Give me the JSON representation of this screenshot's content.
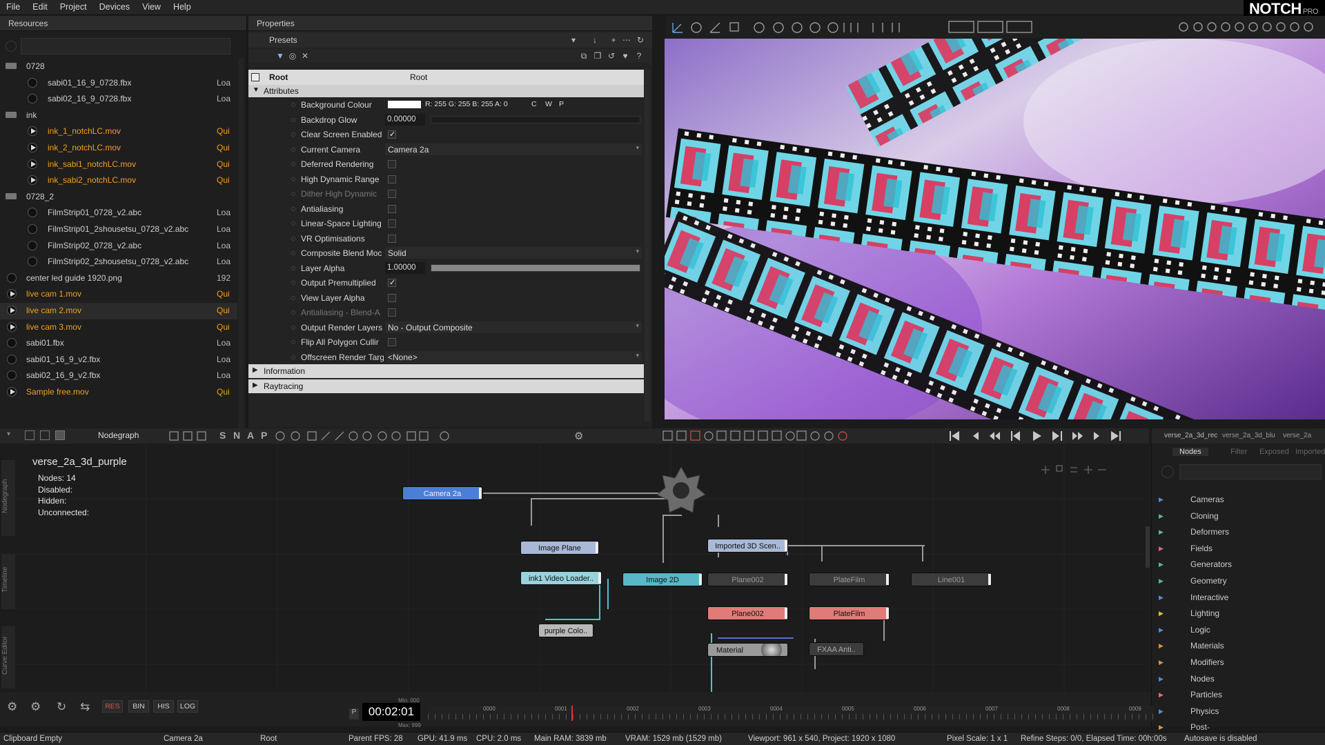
{
  "menu": [
    "File",
    "Edit",
    "Project",
    "Devices",
    "View",
    "Help"
  ],
  "logo": {
    "brand": "NOTCH",
    "edition": "PRO"
  },
  "resources": {
    "title": "Resources",
    "items": [
      {
        "name": "0728",
        "type": "folder",
        "status": ""
      },
      {
        "name": "sabi01_16_9_0728.fbx",
        "type": "model",
        "status": "Loa"
      },
      {
        "name": "sabi02_16_9_0728.fbx",
        "type": "model",
        "status": "Loa"
      },
      {
        "name": "ink",
        "type": "folder",
        "status": ""
      },
      {
        "name": "ink_1_notchLC.mov",
        "type": "video",
        "status": "Qui",
        "highlight": true
      },
      {
        "name": "ink_2_notchLC.mov",
        "type": "video",
        "status": "Qui",
        "highlight": true
      },
      {
        "name": "ink_sabi1_notchLC.mov",
        "type": "video",
        "status": "Qui",
        "highlight": true
      },
      {
        "name": "ink_sabi2_notchLC.mov",
        "type": "video",
        "status": "Qui",
        "highlight": true
      },
      {
        "name": "0728_2",
        "type": "folder",
        "status": ""
      },
      {
        "name": "FilmStrip01_0728_v2.abc",
        "type": "model",
        "status": "Loa"
      },
      {
        "name": "FilmStrip01_2shousetsu_0728_v2.abc",
        "type": "model",
        "status": "Loa"
      },
      {
        "name": "FilmStrip02_0728_v2.abc",
        "type": "model",
        "status": "Loa"
      },
      {
        "name": "FilmStrip02_2shousetsu_0728_v2.abc",
        "type": "model",
        "status": "Loa"
      },
      {
        "name": "center led guide 1920.png",
        "type": "image",
        "status": "192"
      },
      {
        "name": "live cam 1.mov",
        "type": "video",
        "status": "Qui",
        "highlight": true
      },
      {
        "name": "live cam 2.mov",
        "type": "video",
        "status": "Qui",
        "highlight": true,
        "selected": true
      },
      {
        "name": "live cam 3.mov",
        "type": "video",
        "status": "Qui",
        "highlight": true
      },
      {
        "name": "sabi01.fbx",
        "type": "model",
        "status": "Loa"
      },
      {
        "name": "sabi01_16_9_v2.fbx",
        "type": "model",
        "status": "Loa"
      },
      {
        "name": "sabi02_16_9_v2.fbx",
        "type": "model",
        "status": "Loa"
      },
      {
        "name": "Sample free.mov",
        "type": "video",
        "status": "Qui",
        "highlight": true
      }
    ]
  },
  "properties": {
    "title": "Properties",
    "presets_label": "Presets",
    "root_label": "Root",
    "root_value": "Root",
    "attributes_label": "Attributes",
    "rows": [
      {
        "label": "Background Colour",
        "kind": "color",
        "value": "R: 255 G: 255 B: 255 A: 0",
        "extra": [
          "C",
          "W",
          "P"
        ]
      },
      {
        "label": "Backdrop Glow",
        "kind": "number",
        "value": "0.00000",
        "fill": 0
      },
      {
        "label": "Clear Screen Enabled",
        "kind": "check",
        "checked": true
      },
      {
        "label": "Current Camera",
        "kind": "dropdown",
        "value": "Camera 2a"
      },
      {
        "label": "Deferred Rendering",
        "kind": "check",
        "checked": false
      },
      {
        "label": "High Dynamic Range",
        "kind": "check",
        "checked": false
      },
      {
        "label": "Dither High Dynamic",
        "kind": "check",
        "checked": false,
        "dim": true
      },
      {
        "label": "Antialiasing",
        "kind": "check",
        "checked": false
      },
      {
        "label": "Linear-Space Lighting",
        "kind": "check",
        "checked": false
      },
      {
        "label": "VR Optimisations",
        "kind": "check",
        "checked": false
      },
      {
        "label": "Composite Blend Moc",
        "kind": "dropdown",
        "value": "Solid"
      },
      {
        "label": "Layer Alpha",
        "kind": "number",
        "value": "1.00000",
        "fill": 1
      },
      {
        "label": "Output Premultiplied",
        "kind": "check",
        "checked": true
      },
      {
        "label": "View Layer Alpha",
        "kind": "check",
        "checked": false
      },
      {
        "label": "Antialiasing - Blend-A",
        "kind": "check",
        "checked": false,
        "dim": true
      },
      {
        "label": "Output Render Layers",
        "kind": "dropdown",
        "value": "No - Output Composite"
      },
      {
        "label": "Flip All Polygon Cullir",
        "kind": "check",
        "checked": false
      },
      {
        "label": "Offscreen Render Targ",
        "kind": "dropdown",
        "value": "<None>"
      }
    ],
    "sections": [
      "Information",
      "Raytracing"
    ]
  },
  "nodegraph": {
    "toolbar_label": "Nodegraph",
    "toolbar_letters": [
      "S",
      "N",
      "A",
      "P"
    ],
    "layer_name": "verse_2a_3d_purple",
    "info": [
      {
        "k": "Nodes:",
        "v": "14"
      },
      {
        "k": "Disabled:",
        "v": ""
      },
      {
        "k": "Hidden:",
        "v": ""
      },
      {
        "k": "Unconnected:",
        "v": ""
      }
    ],
    "side_tabs": [
      "Nodegraph",
      "Timeline",
      "Curve Editor"
    ],
    "nodes": [
      {
        "id": "camera",
        "label": "Camera 2a",
        "color": "#4a7fd8"
      },
      {
        "id": "imageplane",
        "label": "Image Plane",
        "color": "#a8b8d6"
      },
      {
        "id": "ink1video",
        "label": "ink1 Video Loader..",
        "color": "#98d2dc"
      },
      {
        "id": "purplecolor",
        "label": "purple Colo..",
        "color": "#b8b8b8"
      },
      {
        "id": "image2d",
        "label": "Image 2D",
        "color": "#59b7c7"
      },
      {
        "id": "imported3d",
        "label": "Imported 3D Scen..",
        "color": "#a8b8d6"
      },
      {
        "id": "plane002a",
        "label": "Plane002",
        "color": "#9a9a9a"
      },
      {
        "id": "platefilm_a",
        "label": "PlateFilm",
        "color": "#9a9a9a"
      },
      {
        "id": "line001",
        "label": "Line001",
        "color": "#9a9a9a"
      },
      {
        "id": "plane002b",
        "label": "Plane002",
        "color": "#e07b77"
      },
      {
        "id": "platefilm_b",
        "label": "PlateFilm",
        "color": "#e07b77"
      },
      {
        "id": "material",
        "label": "Material",
        "color": "#9a9a9a"
      },
      {
        "id": "fxaa",
        "label": "FXAA Anti..",
        "color": "#a6a6a6"
      }
    ]
  },
  "nodes_panel": {
    "tabs": [
      "Nodes",
      "Filter",
      "Exposed",
      "Imported"
    ],
    "layer_tabs": [
      "verse_2a_3d_rec",
      "verse_2a_3d_blu",
      "verse_2a"
    ],
    "categories": [
      {
        "name": "Cameras",
        "color": "#4a90d9"
      },
      {
        "name": "Cloning",
        "color": "#55b5a5"
      },
      {
        "name": "Deformers",
        "color": "#55b5a5"
      },
      {
        "name": "Fields",
        "color": "#d86a7a"
      },
      {
        "name": "Generators",
        "color": "#55b5a5"
      },
      {
        "name": "Geometry",
        "color": "#55b5a5"
      },
      {
        "name": "Interactive",
        "color": "#4a90d9"
      },
      {
        "name": "Lighting",
        "color": "#e0c040"
      },
      {
        "name": "Logic",
        "color": "#4a90d9"
      },
      {
        "name": "Materials",
        "color": "#e09040"
      },
      {
        "name": "Modifiers",
        "color": "#e09040"
      },
      {
        "name": "Nodes",
        "color": "#4a90d9"
      },
      {
        "name": "Particles",
        "color": "#e07070"
      },
      {
        "name": "Physics",
        "color": "#4a90d9"
      },
      {
        "name": "Post-FX",
        "color": "#e09040"
      }
    ]
  },
  "bottom": {
    "buttons": [
      "RES",
      "BIN",
      "HIS",
      "LOG"
    ],
    "time": "00:02:01",
    "time_prefix": "P",
    "min_label": "Min: 000",
    "max_label": "Max: 999",
    "ticks": [
      "0000",
      "0001",
      "0002",
      "0003",
      "0004",
      "0005",
      "0006",
      "0007",
      "0008",
      "0009"
    ],
    "playhead_fraction": 0.2
  },
  "status": {
    "clipboard": "Clipboard Empty",
    "camera": "Camera 2a",
    "root": "Root",
    "parent_fps": "Parent FPS: 28",
    "gpu": "GPU: 41.9 ms",
    "cpu": "CPU: 2.0 ms",
    "ram": "Main RAM: 3839 mb",
    "vram": "VRAM: 1529 mb (1529 mb)",
    "viewport": "Viewport: 961 x 540, Project: 1920 x 1080",
    "pixel_scale": "Pixel Scale: 1 x 1",
    "refine": "Refine Steps: 0/0, Elapsed Time: 00h:00s",
    "autosave": "Autosave is disabled"
  },
  "colors": {
    "accent_orange": "#f0a020",
    "node_blue": "#4a7fd8",
    "node_red": "#e07b77",
    "node_cyan": "#59b7c7"
  }
}
